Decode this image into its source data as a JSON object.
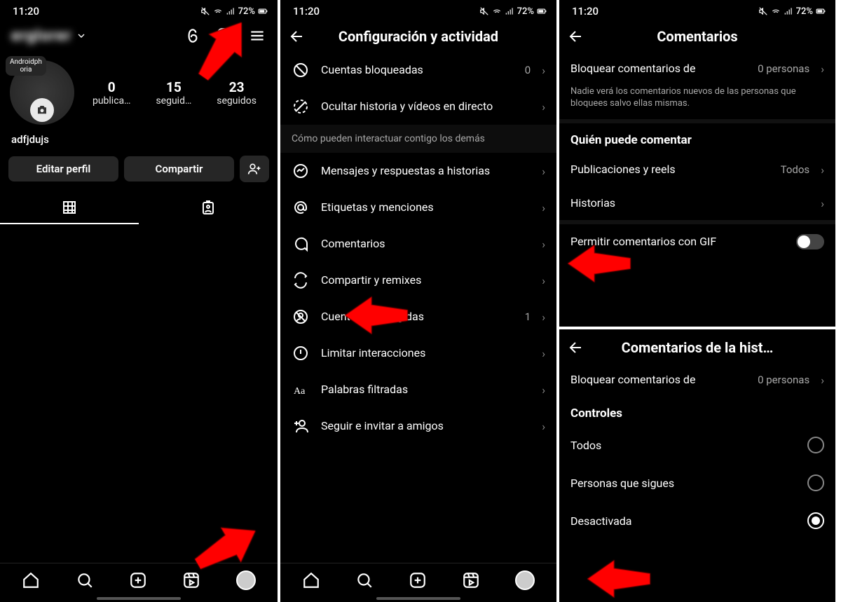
{
  "status": {
    "time": "11:20",
    "battery": "72%"
  },
  "panel1": {
    "username_masked": "erglorer",
    "avatar_badge": "Androidph\noria",
    "stats": [
      {
        "num": "0",
        "label": "publica…"
      },
      {
        "num": "15",
        "label": "seguid…"
      },
      {
        "num": "23",
        "label": "seguidos"
      }
    ],
    "display_name": "adfjdujs",
    "edit_btn": "Editar perfil",
    "share_btn": "Compartir"
  },
  "panel2": {
    "title": "Configuración y actividad",
    "rows_a": [
      {
        "icon": "block",
        "label": "Cuentas bloqueadas",
        "value": "0"
      },
      {
        "icon": "hide",
        "label": "Ocultar historia y vídeos en directo",
        "value": ""
      }
    ],
    "section": "Cómo pueden interactuar contigo los demás",
    "rows_b": [
      {
        "icon": "messenger",
        "label": "Mensajes y respuestas a historias",
        "value": ""
      },
      {
        "icon": "at",
        "label": "Etiquetas y menciones",
        "value": ""
      },
      {
        "icon": "comment",
        "label": "Comentarios",
        "value": ""
      },
      {
        "icon": "remix",
        "label": "Compartir y remixes",
        "value": ""
      },
      {
        "icon": "restrict",
        "label": "Cuentas restringidas",
        "value": "1"
      },
      {
        "icon": "limit",
        "label": "Limitar interacciones",
        "value": ""
      },
      {
        "icon": "words",
        "label": "Palabras filtradas",
        "value": ""
      },
      {
        "icon": "follow",
        "label": "Seguir e invitar a amigos",
        "value": ""
      }
    ]
  },
  "panel3a": {
    "title": "Comentarios",
    "block_label": "Bloquear comentarios de",
    "block_value": "0 personas",
    "block_sub": "Nadie verá los comentarios nuevos de las personas que bloquees salvo ellas mismas.",
    "who_title": "Quién puede comentar",
    "who_rows": [
      {
        "label": "Publicaciones y reels",
        "value": "Todos"
      },
      {
        "label": "Historias",
        "value": ""
      }
    ],
    "gif_label": "Permitir comentarios con GIF"
  },
  "panel3b": {
    "title": "Comentarios de la hist…",
    "block_label": "Bloquear comentarios de",
    "block_value": "0 personas",
    "controls_title": "Controles",
    "options": [
      {
        "label": "Todos",
        "selected": false
      },
      {
        "label": "Personas que sigues",
        "selected": false
      },
      {
        "label": "Desactivada",
        "selected": true
      }
    ]
  }
}
